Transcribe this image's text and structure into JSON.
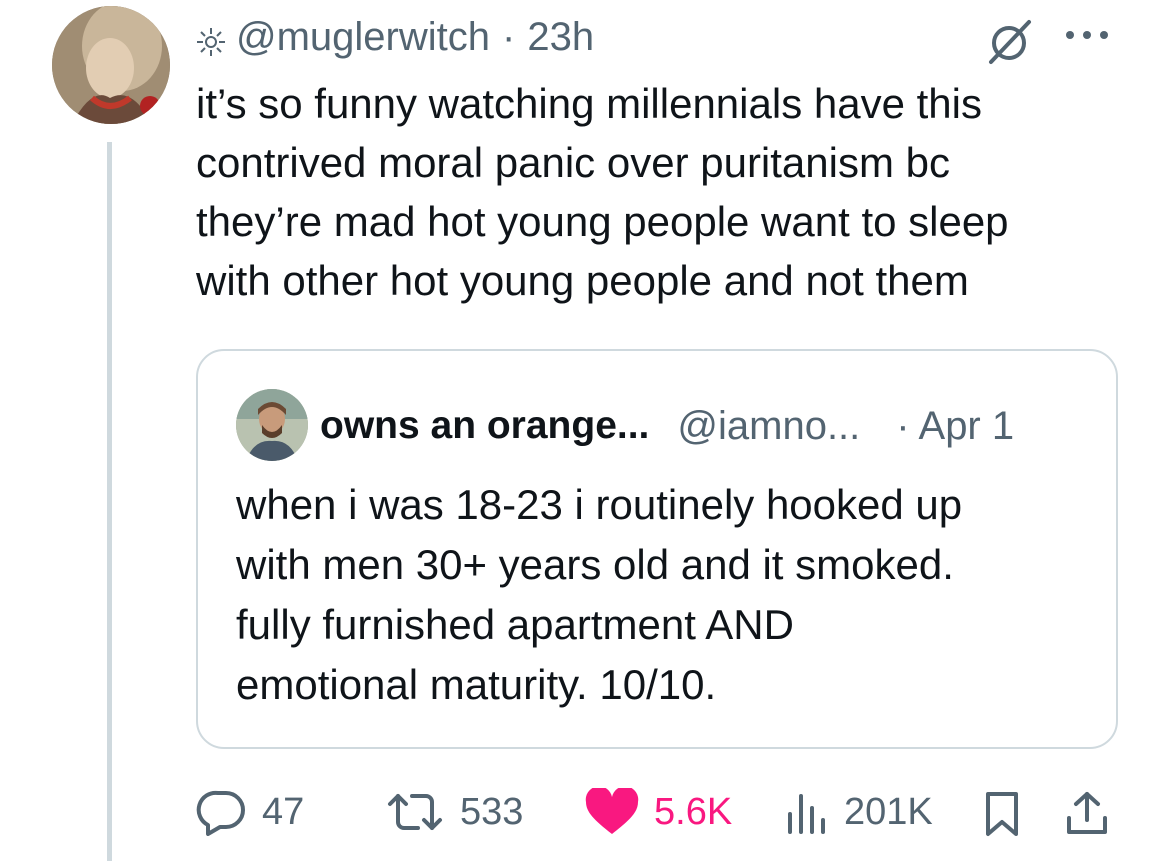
{
  "tweet": {
    "handle": "@muglerwitch",
    "time": "23h",
    "separator": "·",
    "text": "it’s so funny watching millennials have this\ncontrived moral panic over puritanism bc\nthey’re mad hot young people want to sleep\nwith other hot young people and not them"
  },
  "quote": {
    "name": "owns an orange...",
    "handle": "@iamno...",
    "date": "· Apr 1",
    "text": "when i was 18-23 i routinely hooked up\nwith men 30+ years old and it smoked.\nfully furnished apartment AND\nemotional maturity. 10/10."
  },
  "actions": {
    "replies": "47",
    "reposts": "533",
    "likes": "5.6K",
    "views": "201K"
  },
  "icons": {
    "header": [
      "sun-icon",
      "grok-icon",
      "more-icon"
    ],
    "actions": [
      "reply-icon",
      "repost-icon",
      "heart-icon",
      "views-icon",
      "bookmark-icon",
      "share-icon"
    ]
  },
  "colors": {
    "text": "#0f1419",
    "secondary": "#536471",
    "border": "#cfd9de",
    "like": "#f91880"
  }
}
